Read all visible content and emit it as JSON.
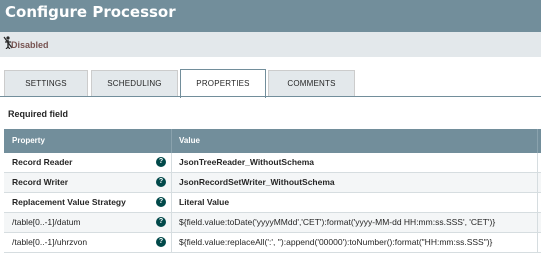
{
  "header": {
    "title": "Configure Processor"
  },
  "status": {
    "label": "Disabled",
    "icon": "disabled-icon"
  },
  "tabs": [
    {
      "label": "SETTINGS",
      "active": false
    },
    {
      "label": "SCHEDULING",
      "active": false
    },
    {
      "label": "PROPERTIES",
      "active": true
    },
    {
      "label": "COMMENTS",
      "active": false
    }
  ],
  "required_label": "Required field",
  "table": {
    "columns": [
      "Property",
      "Value"
    ],
    "rows": [
      {
        "property": "Record Reader",
        "value": "JsonTreeReader_WithoutSchema",
        "required": true
      },
      {
        "property": "Record Writer",
        "value": "JsonRecordSetWriter_WithoutSchema",
        "required": true
      },
      {
        "property": "Replacement Value Strategy",
        "value": "Literal Value",
        "required": true
      },
      {
        "property": "/table[0..-1]/datum",
        "value": "${field.value:toDate('yyyyMMdd','CET'):format('yyyy-MM-dd HH:mm:ss.SSS', 'CET')}",
        "required": false
      },
      {
        "property": "/table[0..-1]/uhrzvon",
        "value": "${field.value:replaceAll(':', ''):append('00000'):toNumber():format(\"HH:mm:ss.SSS\")}",
        "required": false
      }
    ],
    "help_icon": "question-circle-icon"
  },
  "colors": {
    "header_bg": "#728e9b",
    "status_bg": "#e3e8eb",
    "disabled_text": "#775351",
    "help_icon_bg": "#004849"
  }
}
